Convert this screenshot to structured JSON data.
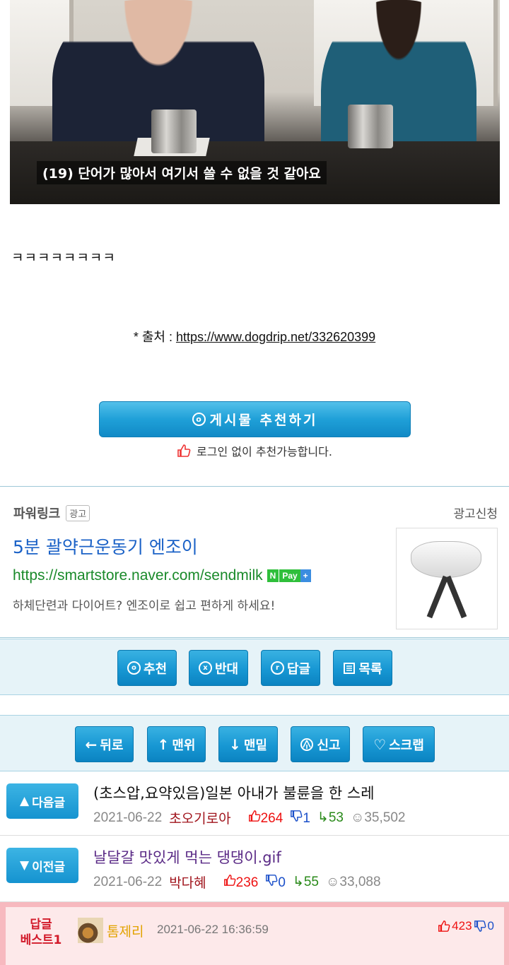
{
  "video": {
    "caption": "(19) 단어가 많아서 여기서 쓸 수 없을 것 같아요"
  },
  "post": {
    "laugh": "ㅋㅋㅋㅋㅋㅋㅋㅋ",
    "source_label": "* 출처 : ",
    "source_url": "https://www.dogdrip.net/332620399"
  },
  "recommend": {
    "button_label": "게시물  추천하기",
    "icon_glyph": "o",
    "note": "로그인 없이 추천가능합니다."
  },
  "ad": {
    "powerlink": "파워링크",
    "badge": "광고",
    "apply": "광고신청",
    "title": "5분 괄약근운동기 엔조이",
    "url": "https://smartstore.naver.com/sendmilk",
    "npay_n": "N",
    "npay_pay": "Pay",
    "npay_plus": "+",
    "description": "하체단련과 다이어트? 엔조이로 쉽고 편하게 하세요!"
  },
  "actions1": [
    {
      "label": "추천",
      "icon": "o"
    },
    {
      "label": "반대",
      "icon": "x"
    },
    {
      "label": "답글",
      "icon": "r"
    },
    {
      "label": "목록",
      "icon": "list"
    }
  ],
  "actions2": [
    {
      "label": "뒤로",
      "icon": "←"
    },
    {
      "label": "맨위",
      "icon": "↑"
    },
    {
      "label": "맨밑",
      "icon": "↓"
    },
    {
      "label": "신고",
      "icon": "warn"
    },
    {
      "label": "스크랩",
      "icon": "♡"
    }
  ],
  "next_post": {
    "button": "다음글",
    "title": "(초스압,요약있음)일본 아내가 불륜을 한 스레",
    "date": "2021-06-22",
    "author": "초오기로아",
    "up": "264",
    "down": "1",
    "replies": "53",
    "views": "35,502"
  },
  "prev_post": {
    "button": "이전글",
    "title": "날달걀 맛있게 먹는 댕댕이.gif",
    "date": "2021-06-22",
    "author": "박다혜",
    "up": "236",
    "down": "0",
    "replies": "55",
    "views": "33,088"
  },
  "best_reply": {
    "label_line1": "답글",
    "label_line2": "베스트1",
    "nickname": "톰제리",
    "datetime": "2021-06-22 16:36:59",
    "up": "423",
    "down": "0"
  },
  "colors": {
    "accent": "#1797d3",
    "best_bg": "#fde9ea",
    "link_green": "#1a8a2a",
    "ad_title": "#1b62c7"
  }
}
